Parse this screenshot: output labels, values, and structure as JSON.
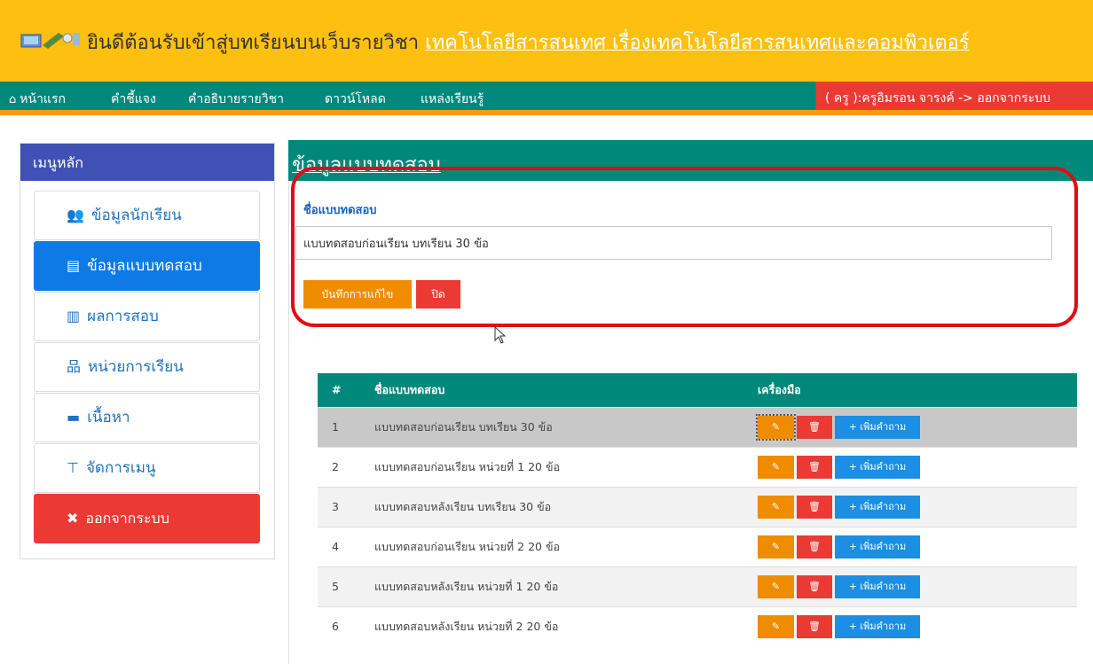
{
  "banner": {
    "prefix": "ยินดีต้อนรับเข้าสู่บทเรียนบนเว็บรายวิชา ",
    "highlight": "เทคโนโลยีสารสนเทศ เรื่องเทคโนโลยีสารสนเทศและคอมพิวเตอร์",
    "logo_icon": "computer-logo-icon"
  },
  "nav": {
    "items": [
      "หน้าแรก",
      "คำชี้แจง",
      "คำอธิบายรายวิชา",
      "ดาวน์โหลด",
      "แหล่งเรียนรู้"
    ],
    "home_icon": "home-icon",
    "user": "( ครู ):ครูอิมรอน จารงค์ -> ออกจากระบบ"
  },
  "sidebar": {
    "title": "เมนูหลัก",
    "items": [
      {
        "label": "ข้อมูลนักเรียน",
        "icon": "users-icon",
        "glyph": "👥"
      },
      {
        "label": "ข้อมูลแบบทดสอบ",
        "icon": "copy-icon",
        "glyph": "▤"
      },
      {
        "label": "ผลการสอบ",
        "icon": "bar-chart-icon",
        "glyph": "▥"
      },
      {
        "label": "หน่วยการเรียน",
        "icon": "sitemap-icon",
        "glyph": "品"
      },
      {
        "label": "เนื้อหา",
        "icon": "book-icon",
        "glyph": "▬"
      },
      {
        "label": "จัดการเมนู",
        "icon": "tree-icon",
        "glyph": "⊤"
      },
      {
        "label": "ออกจากระบบ",
        "icon": "close-icon",
        "glyph": "✖"
      }
    ]
  },
  "main": {
    "title": "ข้อมูลแบบทดสอบ",
    "form": {
      "label": "ชื่อแบบทดสอบ",
      "value": "แบบทดสอบก่อนเรียน บทเรียน 30 ข้อ",
      "save_label": "บันทึกการแก้ไข",
      "close_label": "ปิด"
    },
    "table": {
      "headers": [
        "#",
        "ชื่อแบบทดสอบ",
        "เครื่องมือ"
      ],
      "add_label": "+ เพิ่มคำถาม",
      "edit_icon": "edit-icon",
      "delete_icon": "trash-icon",
      "rows": [
        {
          "num": "1",
          "name": "แบบทดสอบก่อนเรียน บทเรียน 30 ข้อ"
        },
        {
          "num": "2",
          "name": "แบบทดสอบก่อนเรียน หน่วยที่ 1 20 ข้อ"
        },
        {
          "num": "3",
          "name": "แบบทดสอบหลังเรียน บทเรียน 30 ข้อ"
        },
        {
          "num": "4",
          "name": "แบบทดสอบก่อนเรียน หน่วยที่ 2 20 ข้อ"
        },
        {
          "num": "5",
          "name": "แบบทดสอบหลังเรียน หน่วยที่ 1 20 ข้อ"
        },
        {
          "num": "6",
          "name": "แบบทดสอบหลังเรียน หน่วยที่ 2 20 ข้อ"
        }
      ]
    }
  },
  "colors": {
    "banner": "#fdc010",
    "teal": "#00897b",
    "orange": "#f08c00",
    "red": "#ea3a33",
    "blue": "#1a8fe3",
    "indigo": "#3f51b5"
  }
}
